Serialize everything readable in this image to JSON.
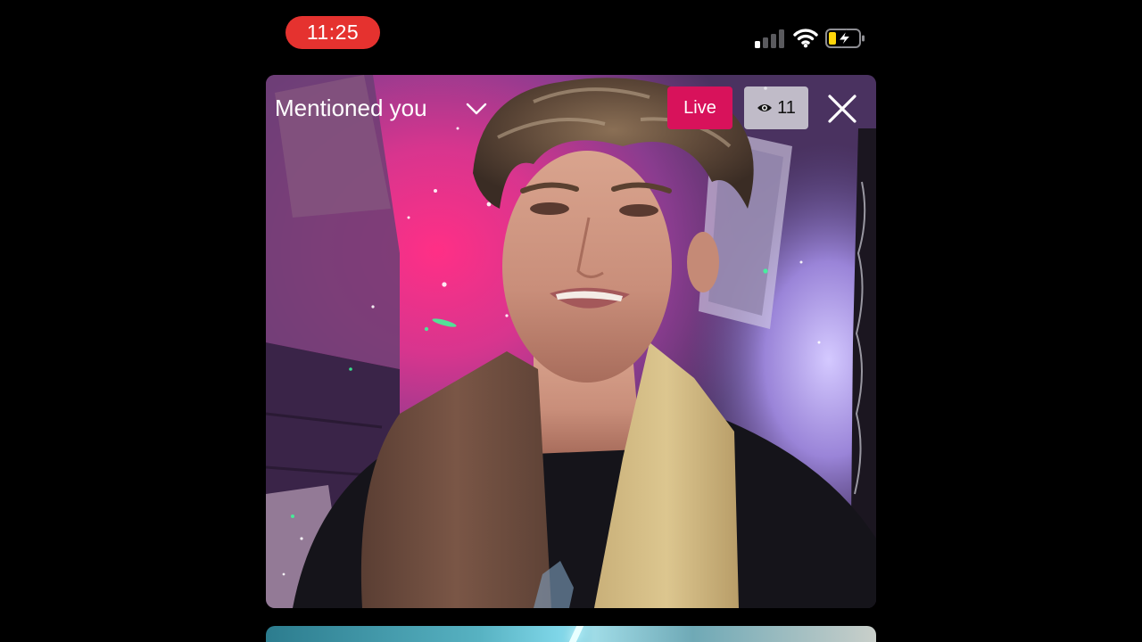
{
  "status_bar": {
    "time": "11:25",
    "icons": [
      "cellular-signal-icon",
      "wifi-icon",
      "battery-charging-icon"
    ],
    "time_pill_color": "#e5322f",
    "battery_fill_color": "#ffd60a"
  },
  "live_card": {
    "title": "Mentioned you",
    "title_icon": "chevron-down-icon",
    "live_label": "Live",
    "live_badge_color": "#d8125b",
    "viewer_icon": "eye-icon",
    "viewer_count": "11",
    "close_icon": "close-icon"
  },
  "next_card": {
    "icon": "light-streak-icon"
  }
}
